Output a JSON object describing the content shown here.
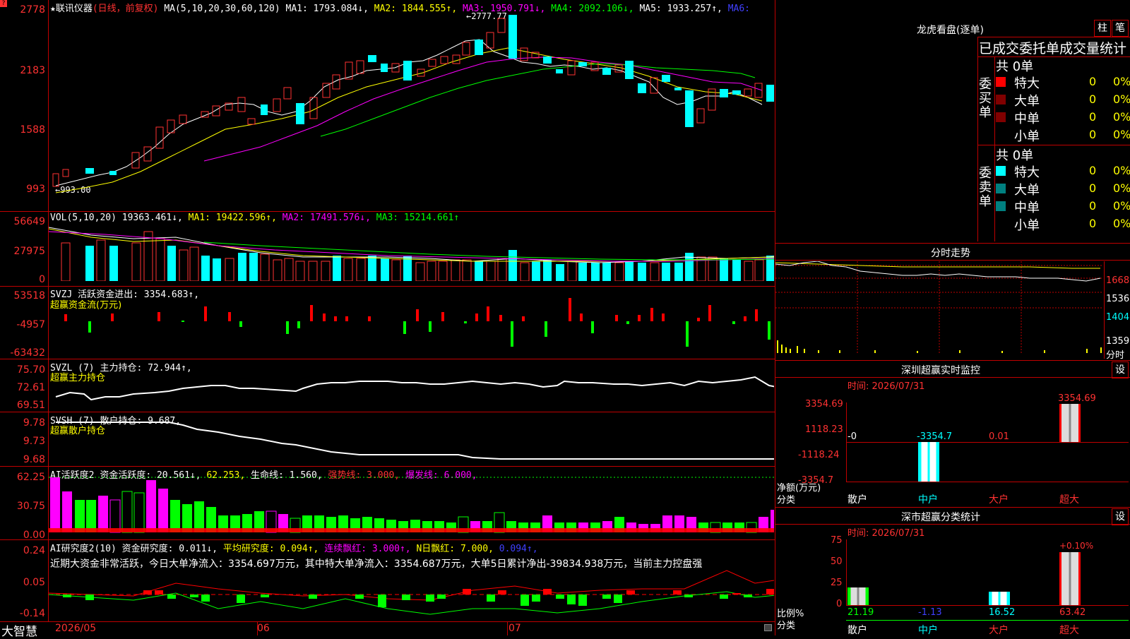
{
  "window": {
    "logo": "大智慧",
    "date_start": "2026/05",
    "date_m6": "06",
    "date_m7": "07",
    "badge": "?"
  },
  "price": {
    "title": "★联讯仪器",
    "mode": "(日线，前复权)",
    "ma_label": "MA(5,10,20,30,60,120)",
    "ma1": "MA1: 1793.084↓,",
    "ma2": "MA2: 1844.555↑,",
    "ma3": "MA3: 1950.791↓,",
    "ma4": "MA4: 2092.106↓,",
    "ma5": "MA5: 1933.257↑,",
    "ma6": "MA6:",
    "axis": [
      "2778",
      "2183",
      "1588",
      "993"
    ],
    "high_label": "2777.77",
    "low_label": "993.00"
  },
  "vol": {
    "label": "VOL(5,10,20)",
    "v": "19363.461↓,",
    "ma1": "MA1: 19422.596↑,",
    "ma2": "MA2: 17491.576↓,",
    "ma3": "MA3: 15214.661↑",
    "axis": [
      "56649",
      "27975",
      "0"
    ]
  },
  "svzj": {
    "label": "SVZJ",
    "l1": "活跃资金进出: 3354.683↑,",
    "l2": "超赢资金流(万元)",
    "axis": [
      "53518",
      "-4957",
      "-63432"
    ]
  },
  "svzl": {
    "label": "SVZL (7)",
    "l1": "主力持仓: 72.944↑,",
    "l2": "超赢主力持仓",
    "axis": [
      "75.70",
      "72.61",
      "69.51"
    ]
  },
  "svsh": {
    "label": "SVSH (7)",
    "l1": "散户持仓: 9.687,",
    "l2": "超赢散户持仓",
    "axis": [
      "9.78",
      "9.73",
      "9.68"
    ]
  },
  "ai1": {
    "label": "AI活跃度2",
    "l1": "资金活跃度: 20.561↓,",
    "l2": "62.253,",
    "l3": "生命线: 1.560,",
    "l4": "强势线: 3.000,",
    "l5": "爆发线: 6.000,",
    "axis": [
      "62.25",
      "30.75",
      "0.00"
    ]
  },
  "ai2": {
    "label": "AI研究度2(10)",
    "l1": "资金研究度: 0.011↓,",
    "l2": "平均研究度: 0.094↑,",
    "l3": "连续飘红: 3.000↑,",
    "l4": "N日飘红: 7.000,",
    "l5": "0.094↑,",
    "note": "近期大资金非常活跃，今日大单净流入：3354.697万元，其中特大单净流入：3354.687万元，大单5日累计净出-39834.938万元，当前主力控盘强",
    "axis": [
      "0.24",
      "0.05",
      "-0.14"
    ]
  },
  "dragon": {
    "title": "龙虎看盘(逐单)",
    "btn1": "柱",
    "btn2": "笔",
    "header": "已成交委托单成交量统计",
    "buy_label": "委买单",
    "sell_label": "委卖单",
    "buy_total": "共 0单",
    "sell_total": "共 0单",
    "rows": [
      "特大",
      "大单",
      "中单",
      "小单"
    ],
    "zero": "0",
    "pct": "0%",
    "colors": {
      "buy": [
        "#ff0000",
        "#800000",
        "#800000"
      ],
      "sell": [
        "#00ffff",
        "#008080",
        "#008080"
      ]
    }
  },
  "intraday": {
    "title": "分时走势",
    "axis": [
      "1668",
      "1536",
      "1404",
      "1359",
      "分时"
    ]
  },
  "monitor": {
    "title": "深圳超赢实时监控",
    "btn": "设",
    "time": "时间: 2026/07/31",
    "axis": [
      "3354.69",
      "1118.23",
      "-1118.24",
      "-3354.7"
    ],
    "vals": [
      "-0",
      "-3354.7",
      "0.01",
      "3354.69"
    ],
    "ylabel1": "净额(万元)",
    "ylabel2": "分类",
    "cats": [
      "散户",
      "中户",
      "大户",
      "超大"
    ]
  },
  "classify": {
    "title": "深市超赢分类统计",
    "btn": "设",
    "time": "时间: 2026/07/31",
    "axis": [
      "75",
      "50",
      "25",
      "0"
    ],
    "top": "+0.10%",
    "vals": [
      "21.19",
      "-1.13",
      "16.52",
      "63.42"
    ],
    "ylabel1": "比例%",
    "ylabel2": "分类",
    "cats": [
      "散户",
      "中户",
      "大户",
      "超大"
    ]
  }
}
